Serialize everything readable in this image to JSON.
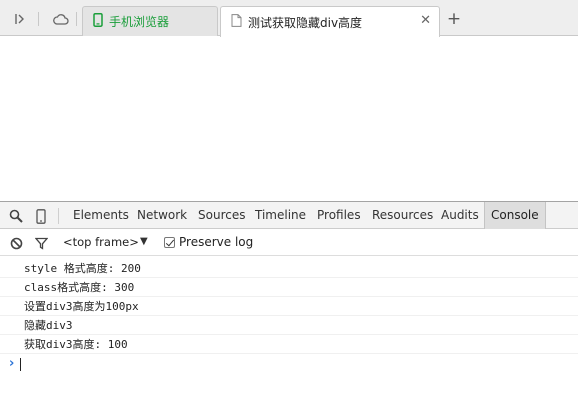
{
  "browser": {
    "tabs": [
      {
        "label": "手机浏览器",
        "icon": "mobile-icon",
        "active": false
      },
      {
        "label": "测试获取隐藏div高度",
        "icon": "page-icon",
        "active": true
      }
    ],
    "colors": {
      "green_tab": "#1a9e3a",
      "strip_bg": "#eeeeee"
    }
  },
  "devtools": {
    "tabs": [
      "Elements",
      "Network",
      "Sources",
      "Timeline",
      "Profiles",
      "Resources",
      "Audits",
      "Console"
    ],
    "selected_tab": "Console",
    "toolbar": {
      "frame": "<top frame>",
      "preserve_log_label": "Preserve log",
      "preserve_log_checked": true
    },
    "console_lines": [
      "style 格式高度: 200",
      "class格式高度: 300",
      "设置div3高度为100px",
      "隐藏div3",
      "获取div3高度: 100"
    ],
    "colors": {
      "prompt": "#2b73d6",
      "selected_tab_bg": "#dedede"
    }
  }
}
